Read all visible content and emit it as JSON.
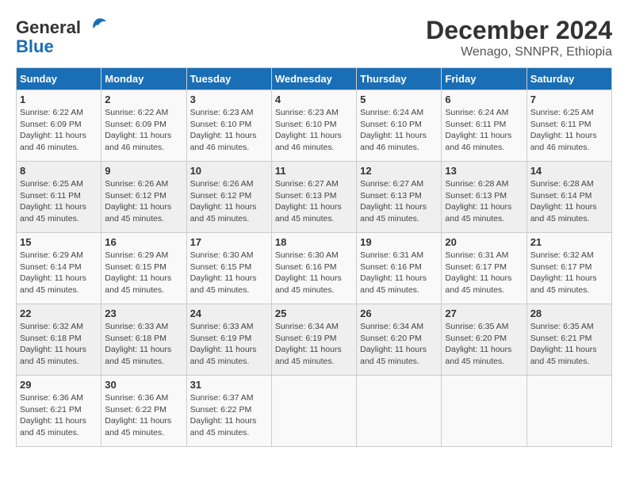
{
  "header": {
    "logo_line1": "General",
    "logo_line2": "Blue",
    "title": "December 2024",
    "subtitle": "Wenago, SNNPR, Ethiopia"
  },
  "weekdays": [
    "Sunday",
    "Monday",
    "Tuesday",
    "Wednesday",
    "Thursday",
    "Friday",
    "Saturday"
  ],
  "weeks": [
    [
      {
        "day": "1",
        "sunrise": "6:22 AM",
        "sunset": "6:09 PM",
        "daylight": "11 hours and 46 minutes."
      },
      {
        "day": "2",
        "sunrise": "6:22 AM",
        "sunset": "6:09 PM",
        "daylight": "11 hours and 46 minutes."
      },
      {
        "day": "3",
        "sunrise": "6:23 AM",
        "sunset": "6:10 PM",
        "daylight": "11 hours and 46 minutes."
      },
      {
        "day": "4",
        "sunrise": "6:23 AM",
        "sunset": "6:10 PM",
        "daylight": "11 hours and 46 minutes."
      },
      {
        "day": "5",
        "sunrise": "6:24 AM",
        "sunset": "6:10 PM",
        "daylight": "11 hours and 46 minutes."
      },
      {
        "day": "6",
        "sunrise": "6:24 AM",
        "sunset": "6:11 PM",
        "daylight": "11 hours and 46 minutes."
      },
      {
        "day": "7",
        "sunrise": "6:25 AM",
        "sunset": "6:11 PM",
        "daylight": "11 hours and 46 minutes."
      }
    ],
    [
      {
        "day": "8",
        "sunrise": "6:25 AM",
        "sunset": "6:11 PM",
        "daylight": "11 hours and 45 minutes."
      },
      {
        "day": "9",
        "sunrise": "6:26 AM",
        "sunset": "6:12 PM",
        "daylight": "11 hours and 45 minutes."
      },
      {
        "day": "10",
        "sunrise": "6:26 AM",
        "sunset": "6:12 PM",
        "daylight": "11 hours and 45 minutes."
      },
      {
        "day": "11",
        "sunrise": "6:27 AM",
        "sunset": "6:13 PM",
        "daylight": "11 hours and 45 minutes."
      },
      {
        "day": "12",
        "sunrise": "6:27 AM",
        "sunset": "6:13 PM",
        "daylight": "11 hours and 45 minutes."
      },
      {
        "day": "13",
        "sunrise": "6:28 AM",
        "sunset": "6:13 PM",
        "daylight": "11 hours and 45 minutes."
      },
      {
        "day": "14",
        "sunrise": "6:28 AM",
        "sunset": "6:14 PM",
        "daylight": "11 hours and 45 minutes."
      }
    ],
    [
      {
        "day": "15",
        "sunrise": "6:29 AM",
        "sunset": "6:14 PM",
        "daylight": "11 hours and 45 minutes."
      },
      {
        "day": "16",
        "sunrise": "6:29 AM",
        "sunset": "6:15 PM",
        "daylight": "11 hours and 45 minutes."
      },
      {
        "day": "17",
        "sunrise": "6:30 AM",
        "sunset": "6:15 PM",
        "daylight": "11 hours and 45 minutes."
      },
      {
        "day": "18",
        "sunrise": "6:30 AM",
        "sunset": "6:16 PM",
        "daylight": "11 hours and 45 minutes."
      },
      {
        "day": "19",
        "sunrise": "6:31 AM",
        "sunset": "6:16 PM",
        "daylight": "11 hours and 45 minutes."
      },
      {
        "day": "20",
        "sunrise": "6:31 AM",
        "sunset": "6:17 PM",
        "daylight": "11 hours and 45 minutes."
      },
      {
        "day": "21",
        "sunrise": "6:32 AM",
        "sunset": "6:17 PM",
        "daylight": "11 hours and 45 minutes."
      }
    ],
    [
      {
        "day": "22",
        "sunrise": "6:32 AM",
        "sunset": "6:18 PM",
        "daylight": "11 hours and 45 minutes."
      },
      {
        "day": "23",
        "sunrise": "6:33 AM",
        "sunset": "6:18 PM",
        "daylight": "11 hours and 45 minutes."
      },
      {
        "day": "24",
        "sunrise": "6:33 AM",
        "sunset": "6:19 PM",
        "daylight": "11 hours and 45 minutes."
      },
      {
        "day": "25",
        "sunrise": "6:34 AM",
        "sunset": "6:19 PM",
        "daylight": "11 hours and 45 minutes."
      },
      {
        "day": "26",
        "sunrise": "6:34 AM",
        "sunset": "6:20 PM",
        "daylight": "11 hours and 45 minutes."
      },
      {
        "day": "27",
        "sunrise": "6:35 AM",
        "sunset": "6:20 PM",
        "daylight": "11 hours and 45 minutes."
      },
      {
        "day": "28",
        "sunrise": "6:35 AM",
        "sunset": "6:21 PM",
        "daylight": "11 hours and 45 minutes."
      }
    ],
    [
      {
        "day": "29",
        "sunrise": "6:36 AM",
        "sunset": "6:21 PM",
        "daylight": "11 hours and 45 minutes."
      },
      {
        "day": "30",
        "sunrise": "6:36 AM",
        "sunset": "6:22 PM",
        "daylight": "11 hours and 45 minutes."
      },
      {
        "day": "31",
        "sunrise": "6:37 AM",
        "sunset": "6:22 PM",
        "daylight": "11 hours and 45 minutes."
      },
      null,
      null,
      null,
      null
    ]
  ]
}
